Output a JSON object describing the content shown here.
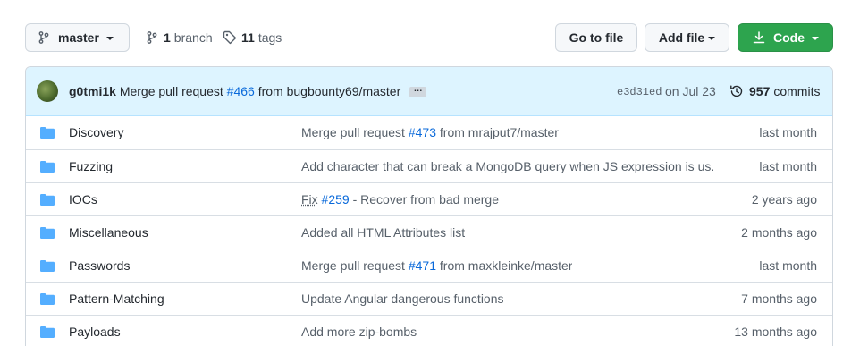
{
  "toolbar": {
    "branch_name": "master",
    "branch_count": "1",
    "branch_label": "branch",
    "tag_count": "11",
    "tag_label": "tags",
    "go_to_file": "Go to file",
    "add_file": "Add file",
    "code": "Code"
  },
  "latest_commit": {
    "author": "g0tmi1k",
    "msg_prefix": "Merge pull request",
    "pr": "#466",
    "msg_suffix": "from bugbounty69/master",
    "ellipsis": "…",
    "sha": "e3d31ed",
    "date": "on Jul 23",
    "count": "957",
    "count_label": "commits"
  },
  "files": [
    {
      "name": "Discovery",
      "msg_prefix": "Merge pull request ",
      "pr": "#473",
      "msg_suffix": " from mrajput7/master",
      "age": "last month"
    },
    {
      "name": "Fuzzing",
      "msg_prefix": "Add character that can break a MongoDB query when JS expression is us...",
      "pr": "",
      "msg_suffix": "",
      "age": "last month"
    },
    {
      "name": "IOCs",
      "msg_prefix": "Fix",
      "pr": " #259",
      "msg_suffix": " - Recover from bad merge",
      "age": "2 years ago"
    },
    {
      "name": "Miscellaneous",
      "msg_prefix": "Added all HTML Attributes list",
      "pr": "",
      "msg_suffix": "",
      "age": "2 months ago"
    },
    {
      "name": "Passwords",
      "msg_prefix": "Merge pull request ",
      "pr": "#471",
      "msg_suffix": " from maxkleinke/master",
      "age": "last month"
    },
    {
      "name": "Pattern-Matching",
      "msg_prefix": "Update Angular dangerous functions",
      "pr": "",
      "msg_suffix": "",
      "age": "7 months ago"
    },
    {
      "name": "Payloads",
      "msg_prefix": "Add more zip-bombs",
      "pr": "",
      "msg_suffix": "",
      "age": "13 months ago"
    }
  ],
  "colors": {
    "folder": "#54aeff",
    "link": "#0969da",
    "code_button": "#2da44e",
    "commit_bar": "#ddf4ff"
  }
}
